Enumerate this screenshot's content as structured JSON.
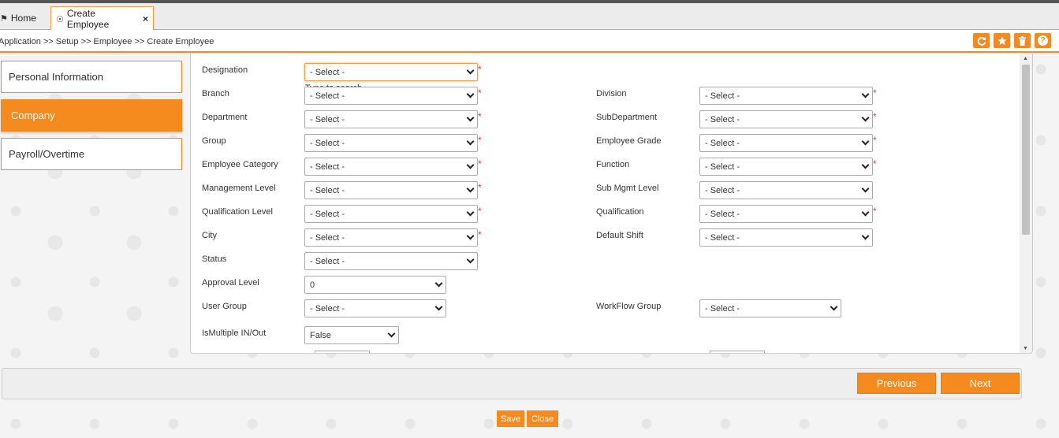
{
  "tabs": [
    {
      "label": "Home",
      "icon": "home-icon"
    },
    {
      "label": "Create Employee",
      "icon": "globe-icon",
      "close": "×"
    }
  ],
  "breadcrumb": "Application >> Setup >> Employee >> Create Employee",
  "toolbar": {
    "refresh_icon": "refresh-icon",
    "star_icon": "star-icon",
    "trash_icon": "trash-icon",
    "help_icon": "help-icon",
    "help_glyph": "?"
  },
  "sidebar": {
    "items": [
      {
        "label": "Personal Information",
        "active": false
      },
      {
        "label": "Company",
        "active": true
      },
      {
        "label": "Payroll/Overtime",
        "active": false
      }
    ]
  },
  "form": {
    "required_mark": "*",
    "type_to_search": "Type to search",
    "designation": {
      "label": "Designation",
      "value": "- Select -"
    },
    "branch": {
      "label": "Branch",
      "value": "- Select -"
    },
    "division": {
      "label": "Division",
      "value": "- Select -"
    },
    "department": {
      "label": "Department",
      "value": "- Select -"
    },
    "subdepartment": {
      "label": "SubDepartment",
      "value": "- Select -"
    },
    "group": {
      "label": "Group",
      "value": "- Select -"
    },
    "employee_grade": {
      "label": "Employee Grade",
      "value": "- Select -"
    },
    "employee_category": {
      "label": "Employee Category",
      "value": "- Select -"
    },
    "function": {
      "label": "Function",
      "value": "- Select -"
    },
    "management_level": {
      "label": "Management Level",
      "value": "- Select -"
    },
    "sub_mgmt_level": {
      "label": "Sub Mgmt Level",
      "value": "- Select -"
    },
    "qualification_level": {
      "label": "Qualification Level",
      "value": "- Select -"
    },
    "qualification": {
      "label": "Qualification",
      "value": "- Select -"
    },
    "city": {
      "label": "City",
      "value": "- Select -"
    },
    "default_shift": {
      "label": "Default Shift",
      "value": "- Select -"
    },
    "status": {
      "label": "Status",
      "value": "- Select -"
    },
    "approval_level": {
      "label": "Approval Level",
      "value": "0"
    },
    "user_group": {
      "label": "User Group",
      "value": "- Select -"
    },
    "workflow_group": {
      "label": "WorkFlow Group",
      "value": "- Select -"
    },
    "is_multiple_inout": {
      "label": "IsMultiple IN/Out",
      "value": "False"
    }
  },
  "navigation": {
    "previous": "Previous",
    "next": "Next"
  },
  "actions": {
    "save": "Save",
    "close": "Close"
  },
  "colors": {
    "accent": "#f58a1f",
    "required": "#e53935"
  }
}
